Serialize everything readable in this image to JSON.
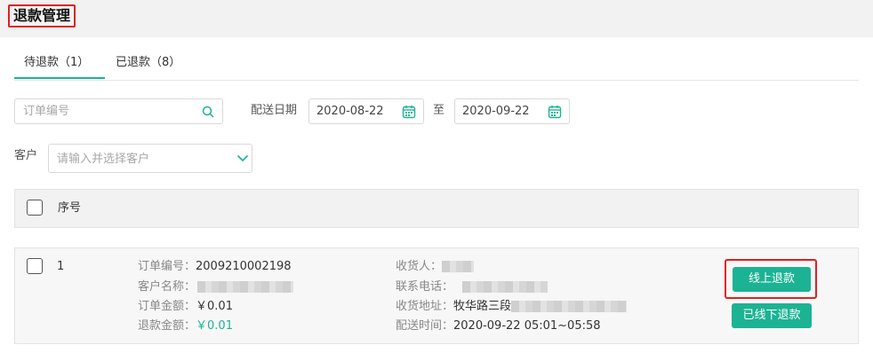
{
  "page": {
    "title": "退款管理"
  },
  "tabs": [
    {
      "label": "待退款（1）",
      "active": true
    },
    {
      "label": "已退款（8）",
      "active": false
    }
  ],
  "filters": {
    "order_search_placeholder": "订单编号",
    "date_label": "配送日期",
    "date_from": "2020-08-22",
    "date_separator": "至",
    "date_to": "2020-09-22",
    "customer_label": "客户",
    "customer_placeholder": "请输入并选择客户"
  },
  "table": {
    "header": {
      "index": "序号"
    },
    "rows": [
      {
        "index": "1",
        "order_no_label": "订单编号：",
        "order_no": "2009210002198",
        "customer_label": "客户名称：",
        "amount_label": "订单金额：",
        "amount": "￥0.01",
        "refund_label": "退款金额：",
        "refund": "￥0.01",
        "receiver_label": "收货人：",
        "phone_label": "联系电话：",
        "address_label": "收货地址：",
        "address": "牧华路三段",
        "delivery_time_label": "配送时间：",
        "delivery_time": "2020-09-22 05:01~05:58",
        "online_refund_label": "线上退款",
        "offline_refund_label": "已线下退款"
      }
    ]
  },
  "colors": {
    "accent": "#1bb394",
    "highlight": "#e02020"
  },
  "icons": [
    "search-icon",
    "calendar-icon",
    "chevron-down-icon"
  ]
}
